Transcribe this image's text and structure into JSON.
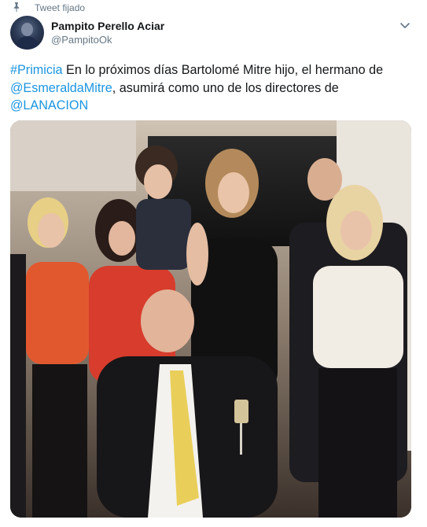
{
  "pinned": {
    "label": "Tweet fijado",
    "icon": "pin-icon"
  },
  "author": {
    "name": "Pampito Perello Aciar",
    "handle": "@PampitoOk",
    "avatar_icon": "avatar"
  },
  "menu": {
    "icon": "chevron-down-icon"
  },
  "tweet": {
    "hashtag": "#Primicia",
    "text_1": " En lo próximos días Bartolomé Mitre hijo, el hermano de ",
    "mention_1": "@EsmeraldaMitre",
    "text_2": ", asumirá como uno de los directores de ",
    "mention_2": "@LANACION"
  },
  "media": {
    "type": "photo"
  },
  "colors": {
    "link": "#1b95e0",
    "secondary_text": "#657786",
    "primary_text": "#14171a"
  }
}
